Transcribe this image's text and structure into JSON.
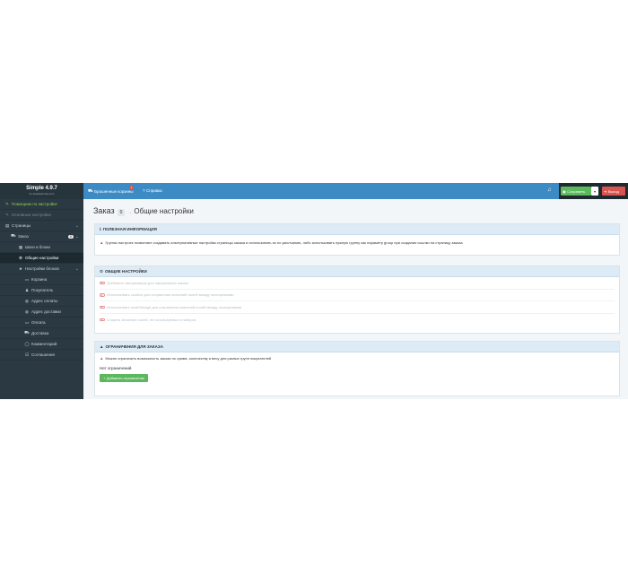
{
  "sidebar": {
    "brand_title": "Simple 4.9.7",
    "brand_subtitle": "by deeplearning.com",
    "items": [
      {
        "label": "Помощник по настройке",
        "icon": "magic-icon"
      },
      {
        "label": "Основные настройки",
        "icon": "wrench-icon"
      },
      {
        "label": "Страницы",
        "icon": "file-icon"
      },
      {
        "label": "Заказ",
        "icon": "cart-icon",
        "badge": "0"
      },
      {
        "label": "Шаги и блоки",
        "icon": "grid-icon"
      },
      {
        "label": "Общие настройки",
        "icon": "gear-icon"
      },
      {
        "label": "Настройки блоков",
        "icon": "sliders-icon"
      },
      {
        "label": "Корзина",
        "icon": "basket-icon"
      },
      {
        "label": "Покупатель",
        "icon": "user-icon"
      },
      {
        "label": "Адрес оплаты",
        "icon": "globe-icon"
      },
      {
        "label": "Адрес доставки",
        "icon": "globe-icon"
      },
      {
        "label": "Оплата",
        "icon": "card-icon"
      },
      {
        "label": "Доставка",
        "icon": "truck-icon"
      },
      {
        "label": "Комментарий",
        "icon": "comment-icon"
      },
      {
        "label": "Соглашения",
        "icon": "check-icon"
      }
    ]
  },
  "topbar": {
    "abandoned_carts": "Брошенные корзины",
    "abandoned_count": "1",
    "help": "Справка",
    "save": "Сохранить",
    "exit": "Выход"
  },
  "page": {
    "title": "Заказ",
    "badge": "0",
    "separator": "→",
    "subtitle": "Общие настройки"
  },
  "info_panel": {
    "title": "ПОЛЕЗНАЯ ИНФОРМАЦИЯ",
    "text": "Группы настроек позволяют создавать альтернативные настройки страницы заказа и использовать их по умолчанию, либо использовать нужную группу как параметр group при создании ссылки на страницу заказа"
  },
  "general_panel": {
    "title": "ОБЩИЕ НАСТРОЙКИ",
    "options": [
      "Требовать авторизацию для оформления заказа",
      "Использовать cookies для сохранения значений полей между посещениями",
      "Использовать localStorage для сохранения значений полей между посещениями",
      "Стирать значения полей, не используемых в наборах"
    ]
  },
  "limits_panel": {
    "title": "ОГРАНИЧЕНИЯ ДЛЯ ЗАКАЗА",
    "warning": "Можно ограничить возможность заказа по сумме, количеству и весу для разных групп покупателей",
    "empty": "Нет ограничений",
    "add_button": "Добавить ограничение"
  },
  "colors": {
    "topbar": "#3d8bc4",
    "sidebar": "#2b3a42",
    "save": "#5cb85c",
    "exit": "#d9534f"
  }
}
